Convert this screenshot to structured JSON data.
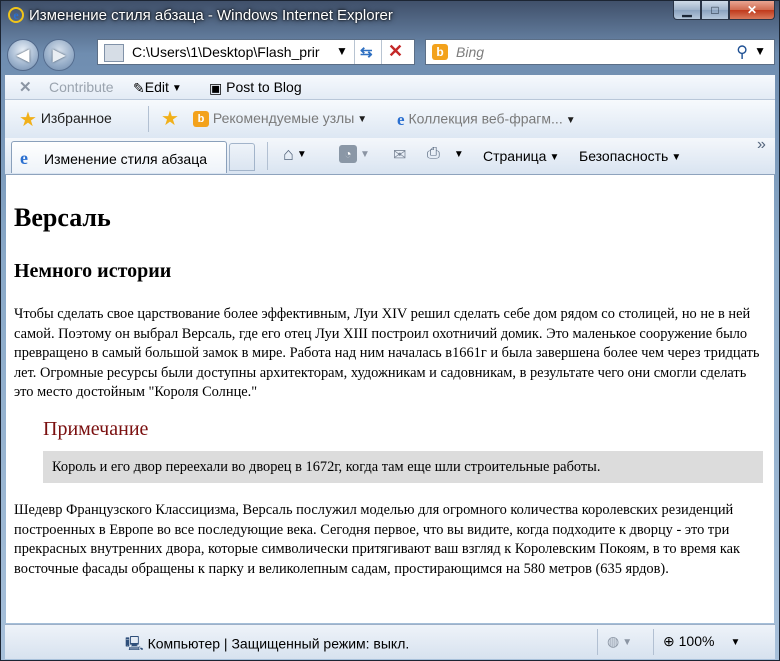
{
  "window": {
    "title": "Изменение стиля абзаца - Windows Internet Explorer",
    "min_glyph": "▁",
    "max_glyph": "□",
    "close_glyph": "✕"
  },
  "nav": {
    "address": "C:\\Users\\1\\Desktop\\Flash_prir",
    "search_placeholder": "Bing",
    "bing_letter": "b"
  },
  "toolbar1": {
    "close_glyph": "✕",
    "contribute": "Contribute",
    "edit": "Edit",
    "post_to_blog": "Post to Blog"
  },
  "favorites_bar": {
    "favorites": "Избранное",
    "suggested_sites": "Рекомендуемые узлы",
    "web_slice_gallery": "Коллекция веб-фрагм..."
  },
  "command_bar": {
    "tab_title": "Изменение стиля абзаца",
    "page": "Страница",
    "safety": "Безопасность",
    "overflow": "»"
  },
  "content": {
    "h1": "Версаль",
    "h2": "Немного истории",
    "p1": "Чтобы сделать свое царствование более эффективным, Луи XIV решил сделать себе дом рядом со столицей, но не в ней самой. Поэтому он выбрал Версаль, где его отец Луи XIII построил охотничий домик. Это маленькое сооружение было превращено в самый большой замок в мире. Работа над ним началась в1661г и была завершена более чем через тридцать лет. Огромные ресурсы были доступны архитекторам, художникам и садовникам, в результате чего они смогли сделать это место достойным \"Короля Солнце.\"",
    "note_title": "Примечание",
    "note_text": "Король и его двор переехали во дворец в 1672г, когда там еще шли строительные работы.",
    "p2": "Шедевр Французского Классицизма, Версаль послужил моделью для огромного количества королевских резиденций построенных в Европе во все последующие века. Сегодня первое, что вы видите, когда подходите к дворцу - это три прекрасных внутренних двора, которые символически притягивают ваш взгляд к Королевским Покоям, в то время как восточные фасады обращены к парку и великолепным садам, простирающимся на 580 метров (635 ярдов)."
  },
  "status": {
    "zone": "Компьютер | Защищенный режим: выкл.",
    "zoom": "100%"
  }
}
